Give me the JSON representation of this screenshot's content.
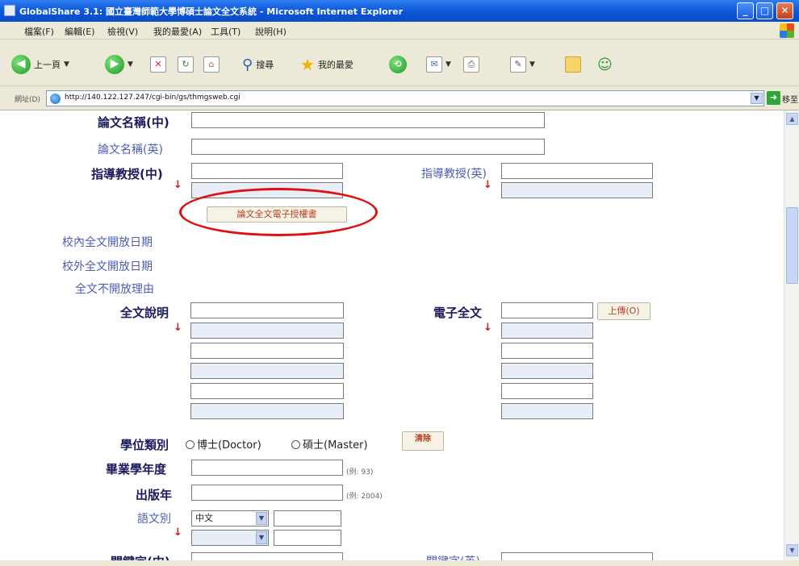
{
  "window": {
    "title": "GlobalShare 3.1: 國立臺灣師範大學博碩士論文全文系統 - Microsoft Internet Explorer",
    "min_glyph": "_",
    "max_glyph": "□",
    "close_glyph": "✕"
  },
  "menu": [
    "檔案(F)",
    "編輯(E)",
    "檢視(V)",
    "我的最愛(A)",
    "工具(T)",
    "說明(H)"
  ],
  "toolbar": {
    "back_label": "上一頁",
    "search_label": "搜尋",
    "favorites_label": "我的最愛"
  },
  "address": {
    "label": "網址(D)",
    "url": "http://140.122.127.247/cgi-bin/gs/thmgsweb.cgi",
    "go_label": "移至"
  },
  "form": {
    "title_zh_label": "論文名稱(中)",
    "title_en_label": "論文名稱(英)",
    "advisor_zh_label": "指導教授(中)",
    "advisor_en_label": "指導教授(英)",
    "auth_button": "論文全文電子授權書",
    "campus_open_date_label": "校內全文開放日期",
    "offcampus_open_date_label": "校外全文開放日期",
    "not_open_reason_label": "全文不開放理由",
    "fulltext_desc_label": "全文說明",
    "electronic_fulltext_label": "電子全文",
    "upload_button": "上傳(O)",
    "degree_label": "學位類別",
    "doctor_option": "博士(Doctor)",
    "master_option": "碩士(Master)",
    "clear_button": "清除",
    "grad_year_label": "畢業學年度",
    "grad_year_hint": "(例: 93)",
    "pub_year_label": "出版年",
    "pub_year_hint": "(例: 2004)",
    "language_label": "語文別",
    "language_value": "中文",
    "keyword_zh_label": "關鍵字(中)",
    "keyword_en_label": "關鍵字(英)",
    "down_arrow": "↓"
  },
  "colors": {
    "highlight_oval": "#e01010",
    "bold_label": "#1a1a5c",
    "light_label": "#4c5db4"
  }
}
